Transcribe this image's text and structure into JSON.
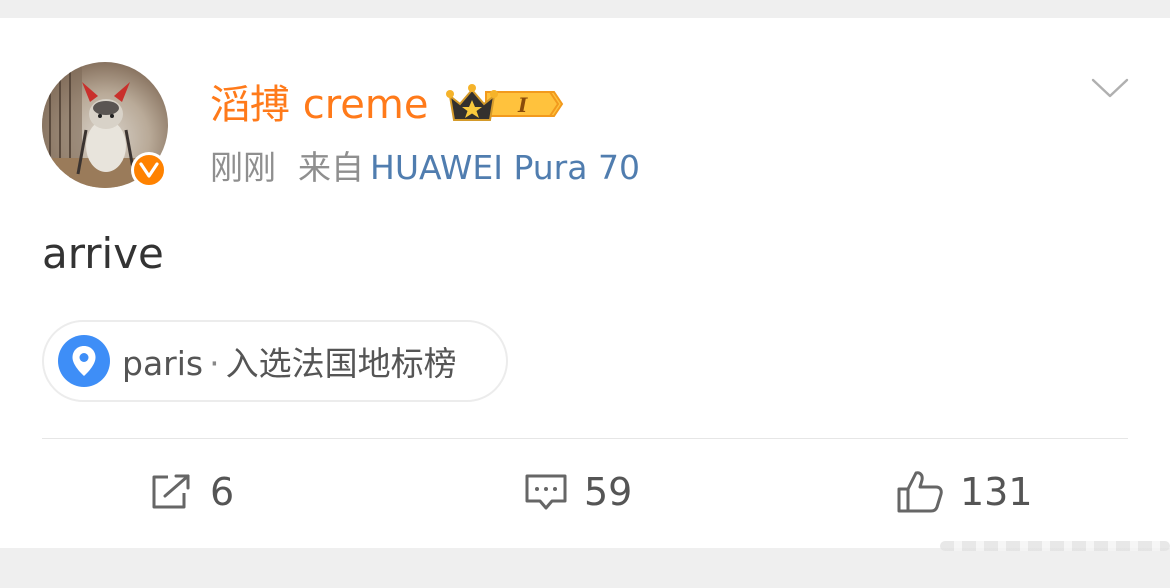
{
  "post": {
    "username": "滔搏 creme",
    "vip_level": "I",
    "time": "刚刚",
    "source_prefix": "来自",
    "device": "HUAWEI Pura 70",
    "content": "arrive",
    "location": {
      "name": "paris",
      "separator": "·",
      "label": "入选法国地标榜"
    }
  },
  "actions": {
    "repost_count": "6",
    "comment_count": "59",
    "like_count": "131"
  },
  "icons": {
    "verified": "verified-v-icon",
    "menu": "chevron-down-icon",
    "location": "location-pin-icon",
    "repost": "repost-icon",
    "comment": "comment-icon",
    "like": "thumbs-up-icon"
  },
  "colors": {
    "username": "#ff7a1a",
    "device": "#507daf",
    "verified": "#ff8200",
    "location_icon": "#3e8ef7"
  }
}
